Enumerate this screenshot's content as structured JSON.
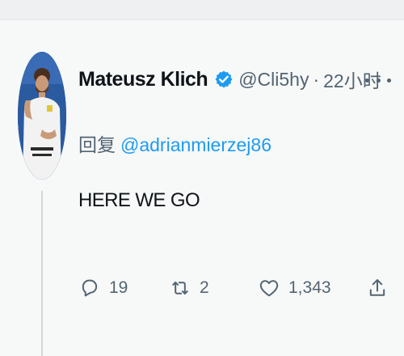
{
  "tweet": {
    "author_name": "Mateusz Klich",
    "handle": "@Cli5hy",
    "separator": "·",
    "time": "22小时",
    "reply_prefix": "回复",
    "reply_to": "@adrianmierzej86",
    "text": "HERE WE GO",
    "actions": {
      "replies": "19",
      "retweets": "2",
      "likes": "1,343"
    }
  },
  "icons": {
    "verified": "verified-badge-icon",
    "more": "more-icon",
    "reply": "reply-icon",
    "retweet": "retweet-icon",
    "like": "heart-icon",
    "share": "share-icon"
  },
  "colors": {
    "accent": "#1d9bf0",
    "secondary_text": "#536471",
    "primary_text": "#0f1419"
  }
}
